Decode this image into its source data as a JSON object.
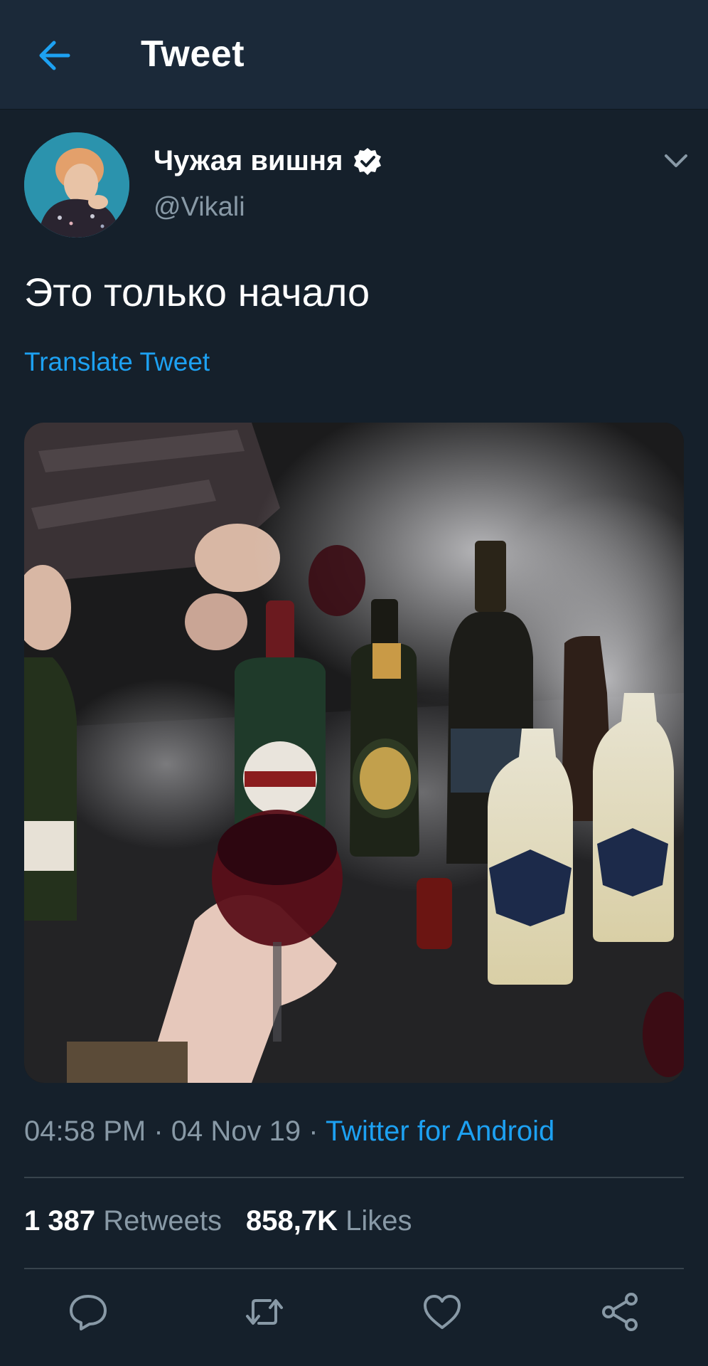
{
  "header": {
    "title": "Tweet",
    "back_icon": "arrow-left-icon"
  },
  "colors": {
    "background": "#15202b",
    "header_bg": "#1b2939",
    "accent": "#1da1f2",
    "secondary_text": "#8899a6",
    "divider": "#38444d"
  },
  "tweet": {
    "author": {
      "display_name": "Чужая вишня",
      "handle": "@Vikali",
      "verified": true
    },
    "text": "Это только начало",
    "translate_label": "Translate Tweet",
    "time": "04:58 PM",
    "date": "04 Nov 19",
    "separator": " · ",
    "source": "Twitter for Android",
    "retweets_count": "1 387",
    "retweets_label": "Retweets",
    "likes_count": "858,7K",
    "likes_label": "Likes"
  },
  "actions": [
    "reply-icon",
    "retweet-icon",
    "like-icon",
    "share-icon"
  ]
}
